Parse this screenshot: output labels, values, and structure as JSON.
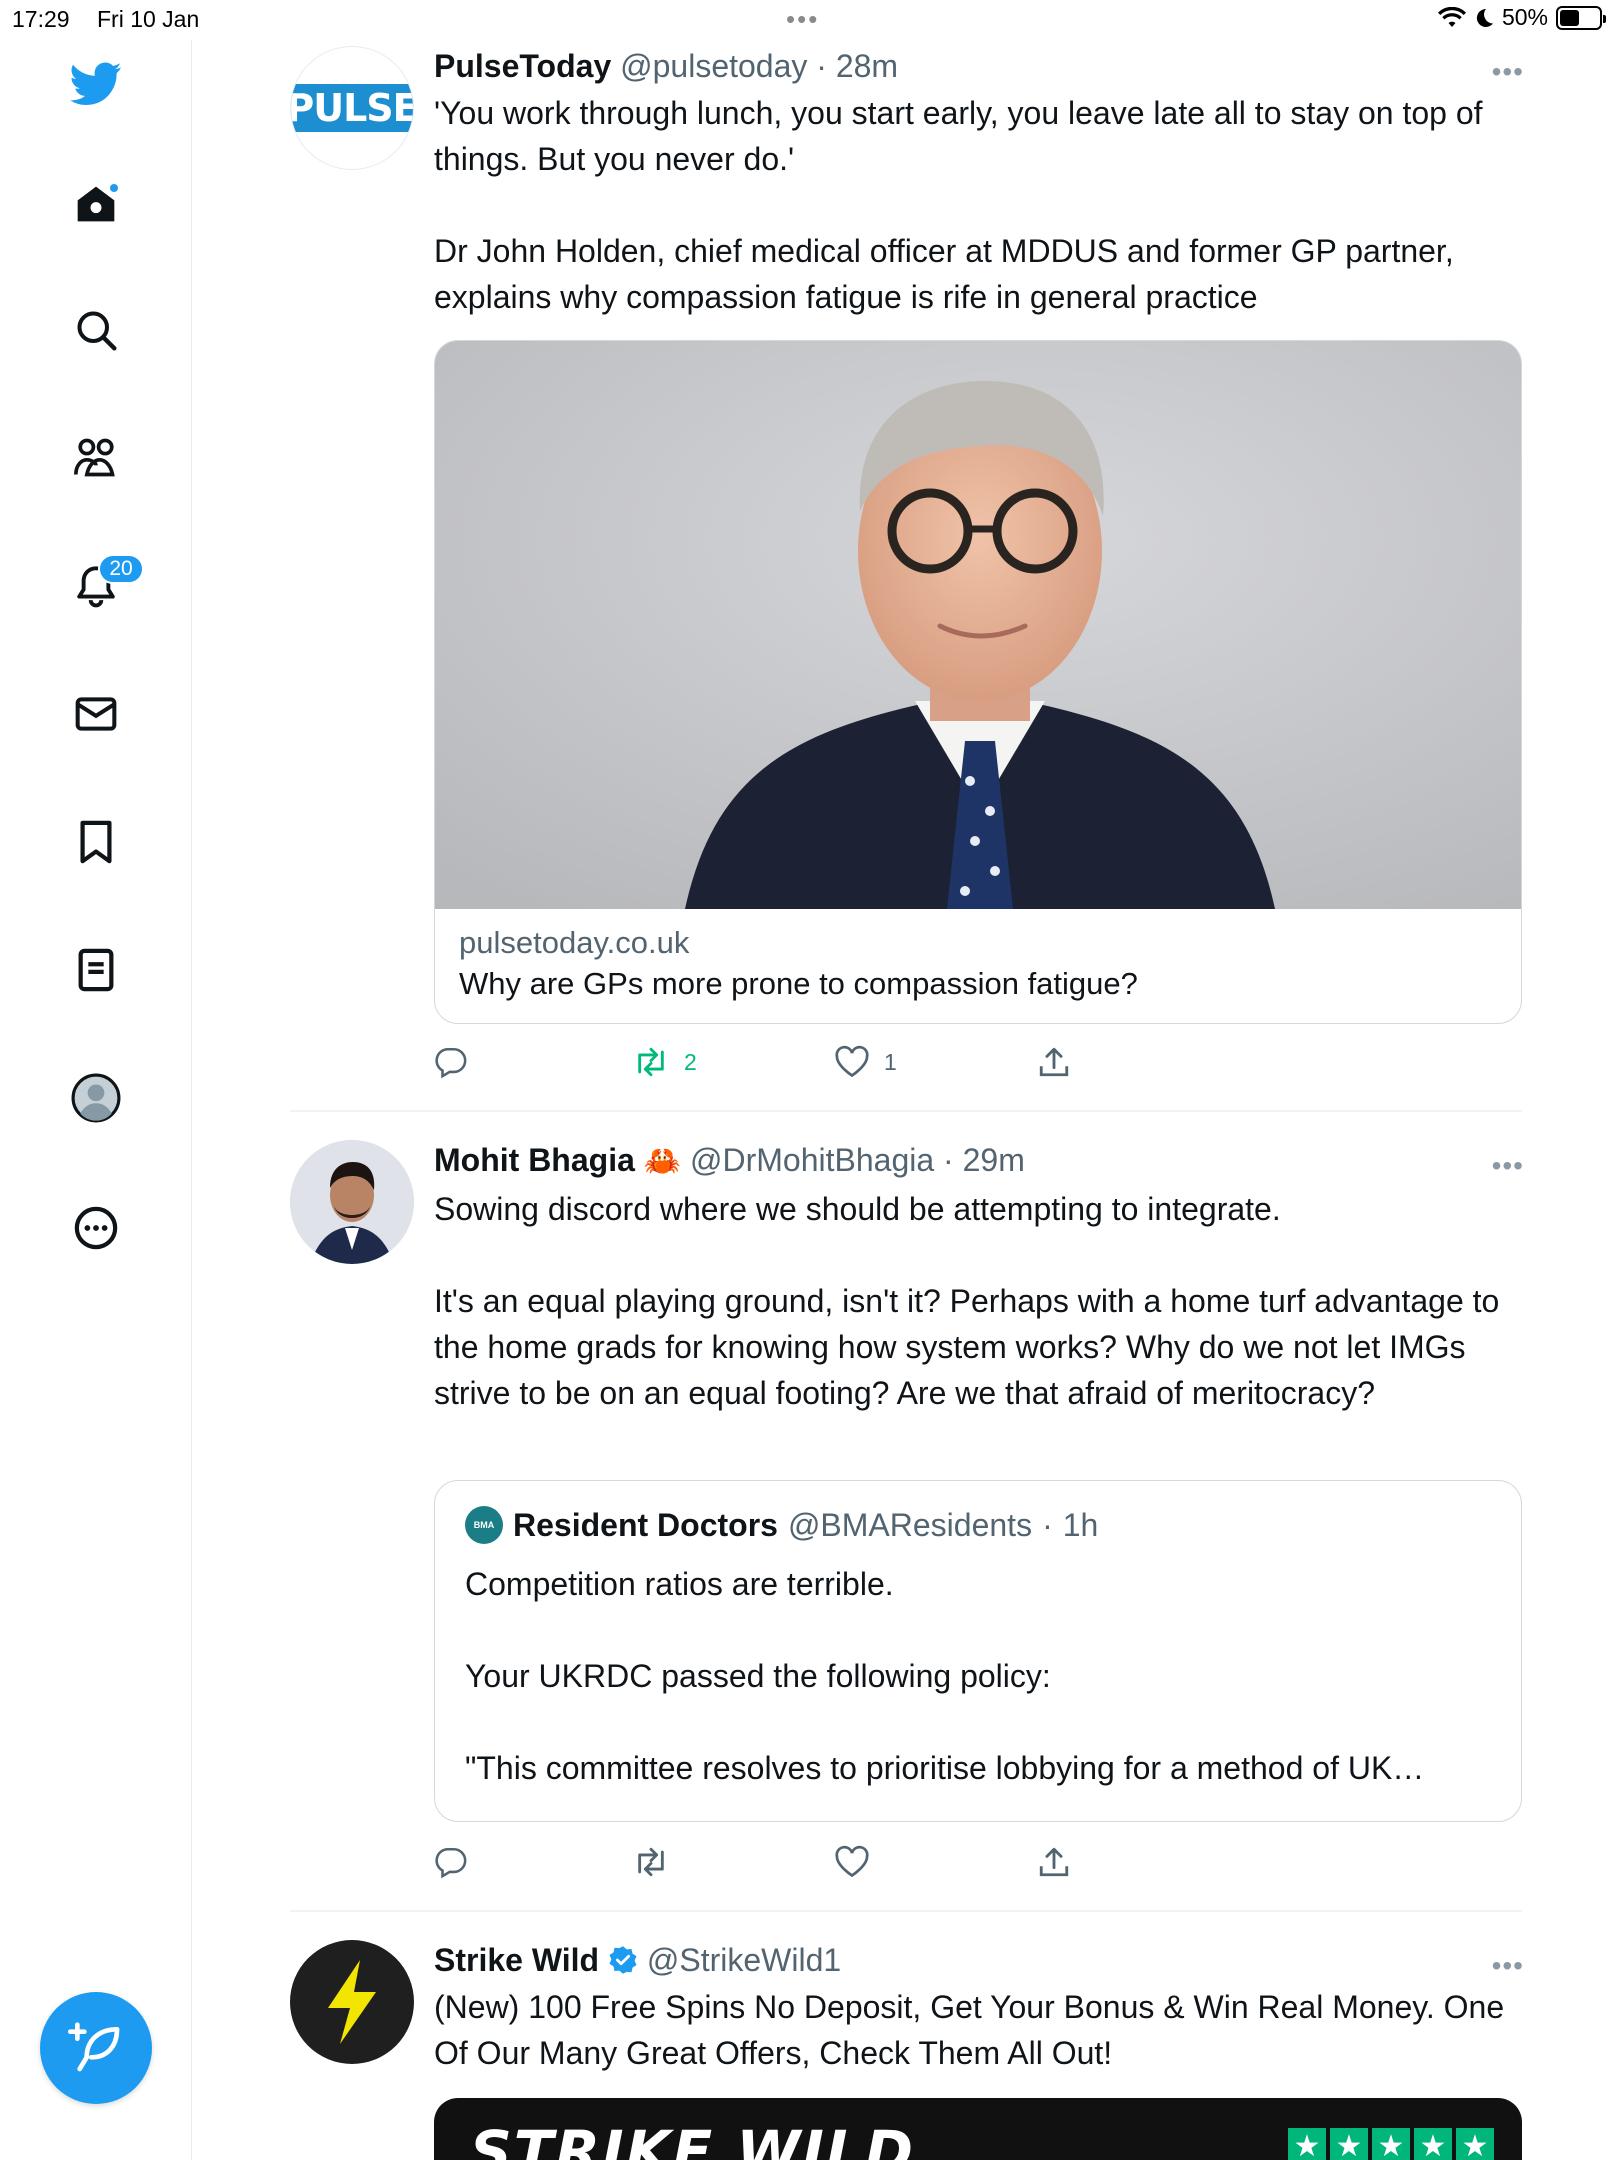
{
  "status_bar": {
    "time": "17:29",
    "date": "Fri 10 Jan",
    "multitask_dots": "•••",
    "battery": "50%",
    "battery_level": 0.5
  },
  "sidebar": {
    "items": [
      {
        "icon": "twitter-logo-icon"
      },
      {
        "icon": "home-icon",
        "has_dot": true
      },
      {
        "icon": "search-icon"
      },
      {
        "icon": "communities-icon"
      },
      {
        "icon": "notifications-icon",
        "badge": "20"
      },
      {
        "icon": "messages-icon"
      },
      {
        "icon": "bookmarks-icon"
      },
      {
        "icon": "lists-icon"
      },
      {
        "icon": "profile-icon"
      },
      {
        "icon": "more-icon"
      }
    ],
    "compose_icon": "compose-tweet-icon"
  },
  "tweets": [
    {
      "name": "PulseToday",
      "handle": "@pulsetoday",
      "time": "28m",
      "avatar_text": "PULSE",
      "text": "'You work through lunch, you start early, you leave late all to stay on top of things. But you never do.'\n\nDr John Holden, chief medical officer at MDDUS and former GP partner, explains why compassion fatigue is rife in general practice",
      "card": {
        "domain": "pulsetoday.co.uk",
        "title": "Why are GPs more prone to compassion fatigue?"
      },
      "actions": {
        "replies": "",
        "retweets": "2",
        "likes": "1"
      }
    },
    {
      "name": "Mohit Bhagia",
      "name_emoji": "🦀",
      "handle": "@DrMohitBhagia",
      "time": "29m",
      "text": "Sowing discord where we should be attempting to integrate.\n\nIt's an equal playing ground, isn't it? Perhaps with a home turf advantage to the home grads for knowing how system works? Why do we not let IMGs strive to be on an equal footing? Are we that afraid of meritocracy?",
      "quote": {
        "avatar_text": "BMA",
        "name": "Resident Doctors",
        "handle": "@BMAResidents",
        "time": "1h",
        "text": "Competition ratios are terrible.\n\nYour UKRDC passed the following policy:\n\n\"This committee resolves to prioritise lobbying for a method of UK…"
      },
      "actions": {
        "replies": "",
        "retweets": "",
        "likes": ""
      }
    },
    {
      "name": "Strike Wild",
      "verified": true,
      "handle": "@StrikeWild1",
      "text": "(New) 100 Free Spins No Deposit, Get Your Bonus & Win Real Money. One Of Our Many Great Offers, Check Them All Out!",
      "promo_text": "STRIKE WILD"
    }
  ],
  "colors": {
    "accent": "#1d9bf0",
    "retweet_active": "#00ba7c",
    "secondary_text": "#536471",
    "border": "#cfd9de"
  }
}
